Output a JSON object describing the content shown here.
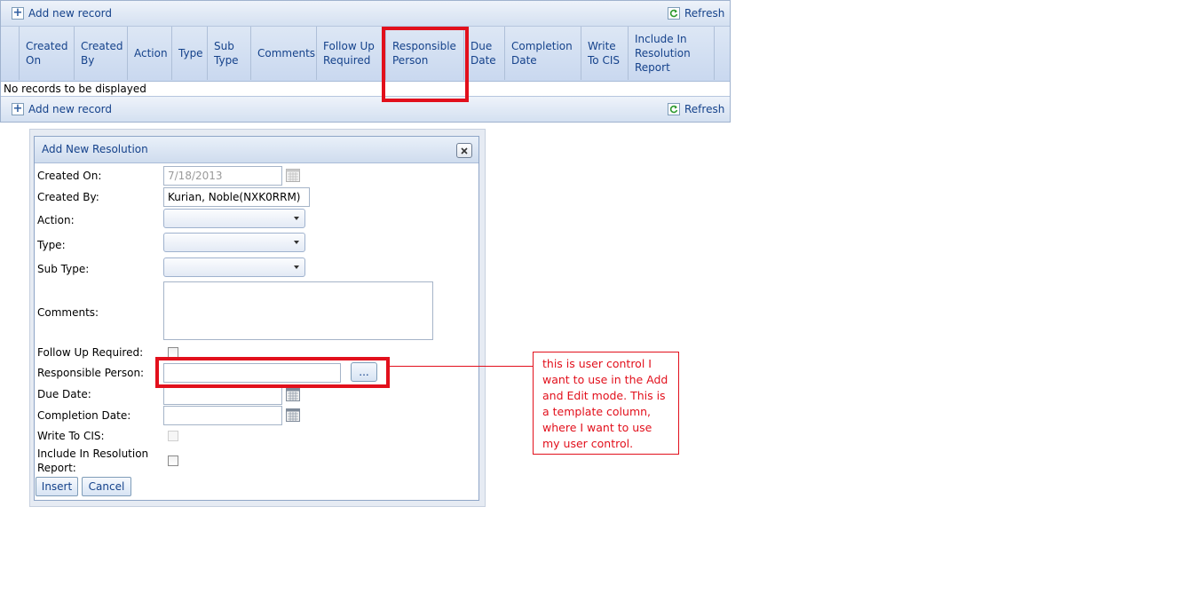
{
  "grid": {
    "add_label": "Add new record",
    "refresh_label": "Refresh",
    "columns": [
      "Created\nOn",
      "Created\nBy",
      "Action",
      "Type",
      "Sub\nType",
      "Comments",
      "Follow Up\nRequired",
      "Responsible\nPerson",
      "Due\nDate",
      "Completion\nDate",
      "Write\nTo CIS",
      "Include In\nResolution\nReport"
    ],
    "empty_text": "No records to be displayed"
  },
  "dialog": {
    "title": "Add New Resolution",
    "fields": {
      "created_on": {
        "label": "Created On:",
        "value": "7/18/2013"
      },
      "created_by": {
        "label": "Created By:",
        "value": "Kurian, Noble(NXK0RRM)"
      },
      "action": {
        "label": "Action:",
        "value": ""
      },
      "type": {
        "label": "Type:",
        "value": ""
      },
      "sub_type": {
        "label": "Sub Type:",
        "value": ""
      },
      "comments": {
        "label": "Comments:",
        "value": ""
      },
      "follow_up": {
        "label": "Follow Up Required:",
        "checked": false
      },
      "responsible_person": {
        "label": "Responsible Person:",
        "value": "",
        "button_label": "..."
      },
      "due_date": {
        "label": "Due Date:",
        "value": ""
      },
      "completion_date": {
        "label": "Completion Date:",
        "value": ""
      },
      "write_to_cis": {
        "label": "Write To CIS:",
        "checked": false
      },
      "include_report": {
        "label": "Include In Resolution\nReport:",
        "checked": false
      }
    },
    "insert_label": "Insert",
    "cancel_label": "Cancel"
  },
  "annotation": {
    "text": "this is user control I want to use in the Add and Edit mode. This is a template column, where I want to use my user control.",
    "color": "#e2101c"
  },
  "colors": {
    "header_text": "#15428b",
    "highlight": "#e2101c"
  }
}
